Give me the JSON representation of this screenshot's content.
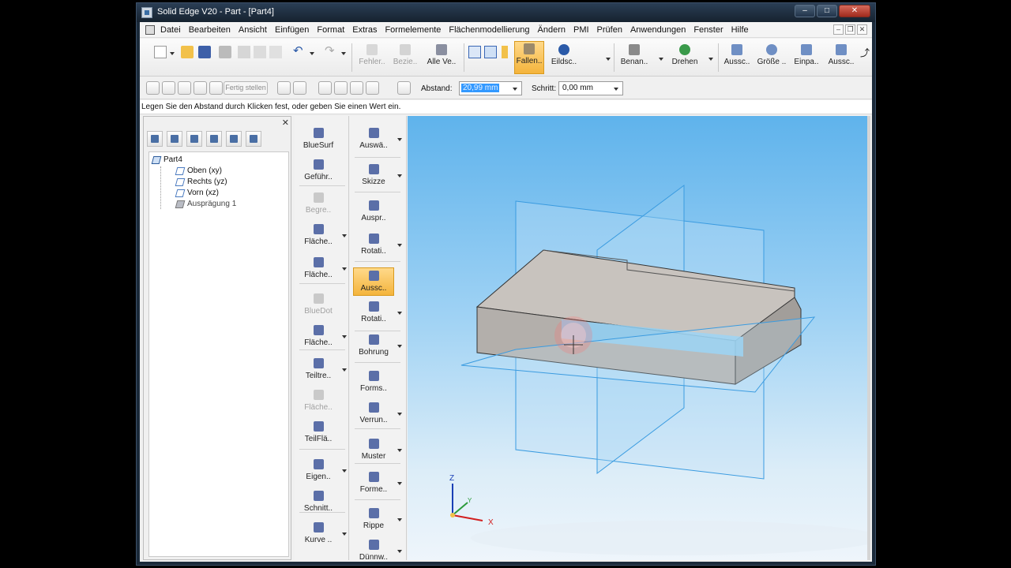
{
  "window": {
    "title": "Solid Edge V20 - Part - [Part4]",
    "minimize": "–",
    "maximize": "□",
    "close": "✕"
  },
  "menu": [
    "Datei",
    "Bearbeiten",
    "Ansicht",
    "Einfügen",
    "Format",
    "Extras",
    "Formelemente",
    "Flächenmodellierung",
    "Ändern",
    "PMI",
    "Prüfen",
    "Anwendungen",
    "Fenster",
    "Hilfe"
  ],
  "ribbon": {
    "fehler": "Fehler..",
    "bezie": "Bezie..",
    "alle": "Alle Ve..",
    "fallen": "Fallen..",
    "eildsc": "Eildsc..",
    "benan": "Benan..",
    "drehen": "Drehen",
    "aussc1": "Aussc..",
    "groesse": "Größe ..",
    "einpa": "Einpa..",
    "aussc2": "Aussc.."
  },
  "cmdbar": {
    "fertig": "Fertig stellen",
    "abstand_label": "Abstand:",
    "abstand_value": "20,99 mm",
    "schritt_label": "Schritt:",
    "schritt_value": "0,00 mm"
  },
  "prompt": "Legen Sie den Abstand durch Klicken fest, oder geben Sie einen Wert ein.",
  "pathfinder": {
    "root": "Part4",
    "items": [
      "Oben (xy)",
      "Rechts (yz)",
      "Vorn (xz)",
      "Ausprägung 1"
    ],
    "close": "✕"
  },
  "palette_left": [
    "BlueSurf",
    "Geführ..",
    "Begre..",
    "Fläche..",
    "Fläche..",
    "BlueDot",
    "Fläche..",
    "Teiltre..",
    "Fläche..",
    "TeilFlä..",
    "Eigen..",
    "Schnitt..",
    "Kurve .."
  ],
  "palette_right": [
    "Auswä..",
    "Skizze",
    "Auspr..",
    "Rotati..",
    "Aussc..",
    "Rotati..",
    "Bohrung",
    "Forms..",
    "Verrun..",
    "Muster",
    "Forme..",
    "Rippe",
    "Dünnw.."
  ],
  "triad": {
    "x": "X",
    "y": "Y",
    "z": "Z"
  },
  "colors": {
    "accent_active": "#f4b43c",
    "viewport_top": "#5fb3ec",
    "plane": "#3a9be0",
    "solid": "#bdb8b3"
  }
}
